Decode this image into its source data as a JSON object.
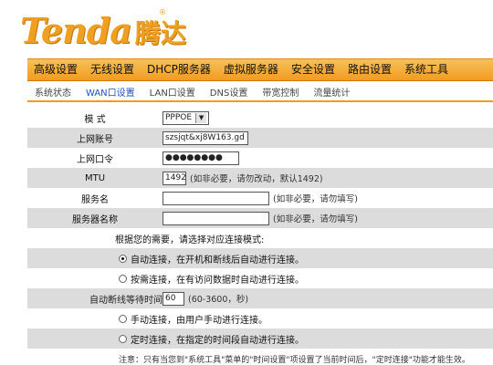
{
  "logo": {
    "latin": "Tenda",
    "chinese": "腾达",
    "reg": "®"
  },
  "nav": [
    "高级设置",
    "无线设置",
    "DHCP服务器",
    "虚拟服务器",
    "安全设置",
    "路由设置",
    "系统工具"
  ],
  "subnav": [
    "系统状态",
    "WAN口设置",
    "LAN口设置",
    "DNS设置",
    "带宽控制",
    "流量统计"
  ],
  "form": {
    "mode": {
      "label": "模  式",
      "value": "PPPOE"
    },
    "username": {
      "label": "上网账号",
      "value": "szsjqt&xj8W163.gd"
    },
    "password": {
      "label": "上网口令",
      "value": "●●●●●●●●"
    },
    "mtu": {
      "label": "MTU",
      "value": "1492",
      "note": "(如非必要，请勿改动，默认1492)"
    },
    "service": {
      "label": "服务名",
      "value": "",
      "note": "(如非必要，请勿填写)"
    },
    "server": {
      "label": "服务器名称",
      "value": "",
      "note": "(如非必要，请勿填写)"
    },
    "conn_title": "根据您的需要，请选择对应连接模式:",
    "auto_connect": "自动连接，在开机和断线后自动进行连接。",
    "on_demand": "按需连接，在有访问数据时自动进行连接。",
    "idle_label": "自动断线等待时间：",
    "idle_value": "60",
    "idle_note": "(60-3600，秒)",
    "manual": "手动连接，由用户手动进行连接。",
    "timed": "定时连接，在指定的时间段自动进行连接。",
    "cut_text": "注意：只有当您到\"系统工具\"菜单的\"时间设置\"项设置了当前时间后，\"定时连接\"功能才能生效。"
  }
}
